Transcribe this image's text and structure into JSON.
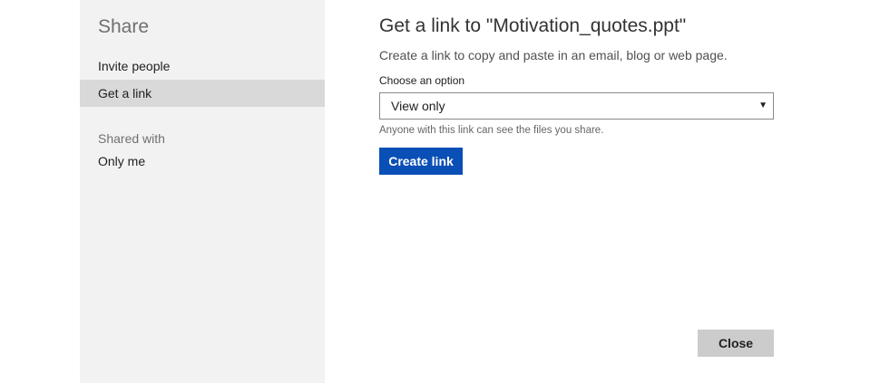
{
  "sidebar": {
    "title": "Share",
    "items": [
      {
        "label": "Invite people",
        "selected": false
      },
      {
        "label": "Get a link",
        "selected": true
      }
    ],
    "shared_with_label": "Shared with",
    "shared_with_value": "Only me"
  },
  "main": {
    "title": "Get a link to \"Motivation_quotes.ppt\"",
    "subtitle": "Create a link to copy and paste in an email, blog or web page.",
    "option_label": "Choose an option",
    "select": {
      "value": "View only",
      "arrow_icon": "triangle-down"
    },
    "option_hint": "Anyone with this link can see the files you share.",
    "create_button_label": "Create link"
  },
  "footer": {
    "close_button_label": "Close"
  },
  "colors": {
    "sidebar_bg": "#f2f2f2",
    "selected_item_bg": "#d9d9d9",
    "primary_button": "#0a4fb5",
    "secondary_button": "#cccccc"
  }
}
